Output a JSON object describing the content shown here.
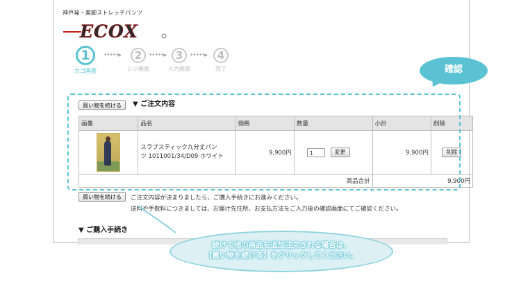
{
  "header": {
    "tagline": "神戸発・美脚ストレッチパンツ",
    "logo_text": "ECOX"
  },
  "steps": [
    {
      "num": "1",
      "label": "カゴ画面",
      "active": true
    },
    {
      "num": "2",
      "label": "レジ画面",
      "active": false
    },
    {
      "num": "3",
      "label": "入力画面",
      "active": false
    },
    {
      "num": "4",
      "label": "完了",
      "active": false
    }
  ],
  "step_arrow": "•••••▸",
  "order_section": {
    "continue_label": "買い物を続ける",
    "title": "▼ ご注文内容"
  },
  "cart": {
    "headers": [
      "画像",
      "品名",
      "価格",
      "数量",
      "小計",
      "削除"
    ],
    "rows": [
      {
        "name_line1": "スラブスティック九分丈パン",
        "name_line2": "ツ 1011001/34/D09 ホワイト",
        "price": "9,900円",
        "qty": "1",
        "change_label": "変更",
        "subtotal": "9,900円",
        "delete_label": "削除"
      }
    ],
    "total_label": "商品合計",
    "total_value": "9,900円"
  },
  "bottom": {
    "continue_label": "買い物を続ける",
    "note1": "ご注文内容が決まりましたら、ご購入手続きにお進みください。",
    "note2": "送料や手数料につきましては、お届け先住所、お支払方法をご入力後の確認画面にてご確認ください。",
    "purchase_title": "▼ ご購入手続き"
  },
  "callouts": {
    "badge": "確認",
    "bubble_line1": "続けて他の商品を追加注文される場合は、",
    "bubble_line2": "【買い物を続ける】をクリックしてください。"
  },
  "colors": {
    "accent": "#5ac2d3",
    "logo_red": "#c21a1a",
    "header_gray": "#e4e4e4"
  }
}
